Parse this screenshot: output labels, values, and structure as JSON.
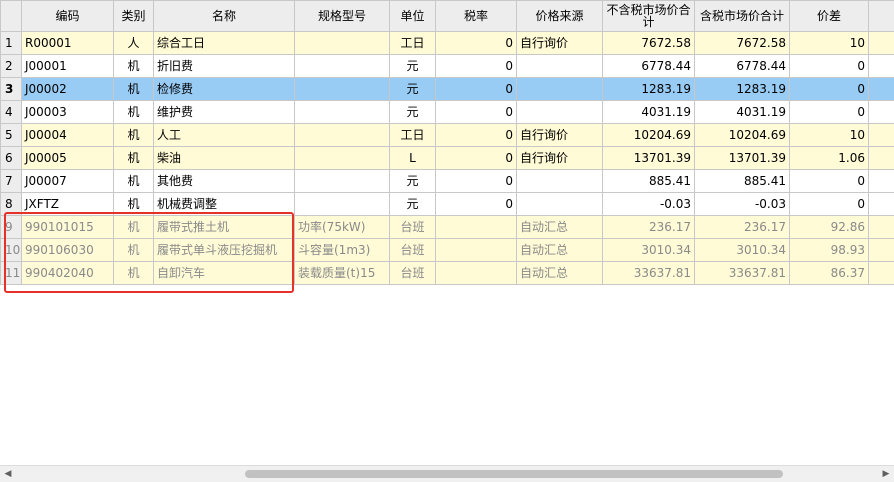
{
  "columns": {
    "rownum": "",
    "code": "编码",
    "category": "类别",
    "name": "名称",
    "spec": "规格型号",
    "unit": "单位",
    "tax_rate": "税率",
    "price_source": "价格来源",
    "price_excl_tax": "不含税市场价合计",
    "price_incl_tax": "含税市场价合计",
    "price_diff": "价差",
    "extra": ""
  },
  "rows": [
    {
      "no": "1",
      "code": "R00001",
      "category": "人",
      "name": "综合工日",
      "spec": "",
      "unit": "工日",
      "tax_rate": "0",
      "price_source": "自行询价",
      "price_excl_tax": "7672.58",
      "price_incl_tax": "7672.58",
      "price_diff": "10"
    },
    {
      "no": "2",
      "code": "J00001",
      "category": "机",
      "name": "折旧费",
      "spec": "",
      "unit": "元",
      "tax_rate": "0",
      "price_source": "",
      "price_excl_tax": "6778.44",
      "price_incl_tax": "6778.44",
      "price_diff": "0"
    },
    {
      "no": "3",
      "code": "J00002",
      "category": "机",
      "name": "检修费",
      "spec": "",
      "unit": "元",
      "tax_rate": "0",
      "price_source": "",
      "price_excl_tax": "1283.19",
      "price_incl_tax": "1283.19",
      "price_diff": "0"
    },
    {
      "no": "4",
      "code": "J00003",
      "category": "机",
      "name": "维护费",
      "spec": "",
      "unit": "元",
      "tax_rate": "0",
      "price_source": "",
      "price_excl_tax": "4031.19",
      "price_incl_tax": "4031.19",
      "price_diff": "0"
    },
    {
      "no": "5",
      "code": "J00004",
      "category": "机",
      "name": "人工",
      "spec": "",
      "unit": "工日",
      "tax_rate": "0",
      "price_source": "自行询价",
      "price_excl_tax": "10204.69",
      "price_incl_tax": "10204.69",
      "price_diff": "10"
    },
    {
      "no": "6",
      "code": "J00005",
      "category": "机",
      "name": "柴油",
      "spec": "",
      "unit": "L",
      "tax_rate": "0",
      "price_source": "自行询价",
      "price_excl_tax": "13701.39",
      "price_incl_tax": "13701.39",
      "price_diff": "1.06"
    },
    {
      "no": "7",
      "code": "J00007",
      "category": "机",
      "name": "其他费",
      "spec": "",
      "unit": "元",
      "tax_rate": "0",
      "price_source": "",
      "price_excl_tax": "885.41",
      "price_incl_tax": "885.41",
      "price_diff": "0"
    },
    {
      "no": "8",
      "code": "JXFTZ",
      "category": "机",
      "name": "机械费调整",
      "spec": "",
      "unit": "元",
      "tax_rate": "0",
      "price_source": "",
      "price_excl_tax": "-0.03",
      "price_incl_tax": "-0.03",
      "price_diff": "0"
    },
    {
      "no": "9",
      "code": "990101015",
      "category": "机",
      "name": "履带式推土机",
      "spec": "功率(75kW)",
      "unit": "台班",
      "tax_rate": "",
      "price_source": "自动汇总",
      "price_excl_tax": "236.17",
      "price_incl_tax": "236.17",
      "price_diff": "92.86"
    },
    {
      "no": "10",
      "code": "990106030",
      "category": "机",
      "name": "履带式单斗液压挖掘机",
      "spec": "斗容量(1m3)",
      "unit": "台班",
      "tax_rate": "",
      "price_source": "自动汇总",
      "price_excl_tax": "3010.34",
      "price_incl_tax": "3010.34",
      "price_diff": "98.93"
    },
    {
      "no": "11",
      "code": "990402040",
      "category": "机",
      "name": "自卸汽车",
      "spec": "装载质量(t)15",
      "unit": "台班",
      "tax_rate": "",
      "price_source": "自动汇总",
      "price_excl_tax": "33637.81",
      "price_incl_tax": "33637.81",
      "price_diff": "86.37"
    }
  ],
  "scrollbar": {
    "left_arrow": "◀",
    "right_arrow": "▶"
  },
  "colors": {
    "selected_row": "#99ccf5",
    "row_yellow": "#fffbd6",
    "highlight_frame": "#e8302a",
    "header_bg": "#ededed"
  }
}
